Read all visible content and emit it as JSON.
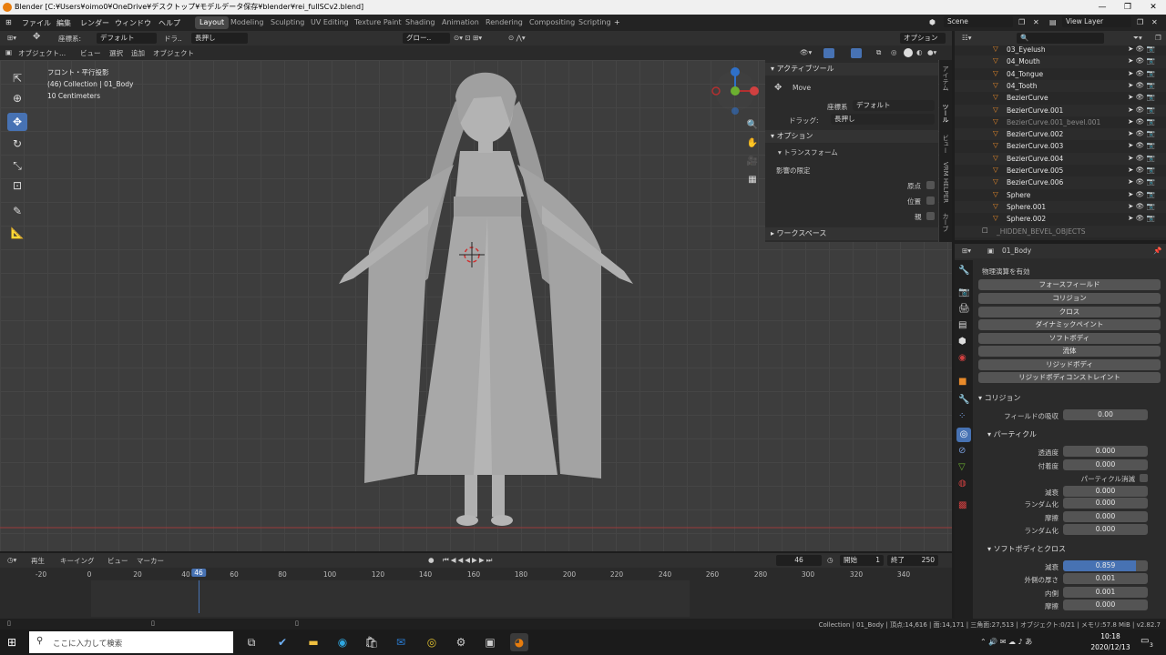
{
  "window": {
    "title": "Blender [C:¥Users¥oimo0¥OneDrive¥デスクトップ¥モデルデータ保存¥blender¥rei_fullSCv2.blend]"
  },
  "menu": [
    "ファイル",
    "編集",
    "レンダー",
    "ウィンドウ",
    "ヘルプ"
  ],
  "workspaces": [
    "Layout",
    "Modeling",
    "Sculpting",
    "UV Editing",
    "Texture Paint",
    "Shading",
    "Animation",
    "Rendering",
    "Compositing",
    "Scripting"
  ],
  "active_workspace": "Layout",
  "scene": "Scene",
  "view_layer": "View Layer",
  "viewport_header": {
    "coord_label": "座標系:",
    "coord_value": "デフォルト",
    "drag_label": "ドラ..",
    "drag_value": "長押し",
    "pivot": "グロー..",
    "options": "オプション"
  },
  "viewport_menu": {
    "mode": "オブジェクト...",
    "items": [
      "ビュー",
      "選択",
      "追加",
      "オブジェクト"
    ]
  },
  "viewport_info": [
    "フロント・平行投影",
    "(46) Collection | 01_Body",
    "10 Centimeters"
  ],
  "npanel": {
    "active_tool_title": "アクティブツール",
    "tool_name": "Move",
    "coord_label": "座標系",
    "coord_value": "デフォルト",
    "drag_label": "ドラッグ:",
    "drag_value": "長押し",
    "options_title": "オプション",
    "transform_title": "トランスフォーム",
    "affect_label": "影響の限定",
    "affect_items": [
      "原点",
      "位置",
      "親"
    ],
    "workspace_title": "ワークスペース",
    "tabs": [
      "アイテム",
      "ツール",
      "ビュー",
      "VRM HELPER",
      "カーブ"
    ]
  },
  "timeline": {
    "menus": [
      "再生",
      "キーイング",
      "ビュー",
      "マーカー"
    ],
    "current_frame": "46",
    "start_label": "開始",
    "start": "1",
    "end_label": "終了",
    "end": "250",
    "ticks": [
      "-20",
      "0",
      "20",
      "40",
      "46",
      "60",
      "80",
      "100",
      "120",
      "140",
      "160",
      "180",
      "200",
      "220",
      "240",
      "260",
      "280",
      "300",
      "320",
      "340"
    ]
  },
  "outliner": {
    "search_placeholder": "",
    "rows": [
      "03_Eyelush",
      "04_Mouth",
      "04_Tongue",
      "04_Tooth",
      "BezierCurve",
      "BezierCurve.001",
      "BezierCurve.001_bevel.001",
      "BezierCurve.002",
      "BezierCurve.003",
      "BezierCurve.004",
      "BezierCurve.005",
      "BezierCurve.006",
      "Sphere",
      "Sphere.001",
      "Sphere.002",
      "_HIDDEN_BEVEL_OBJECTS"
    ]
  },
  "properties": {
    "object_name": "01_Body",
    "physics_header": "物理演算を有効",
    "buttons": [
      "フォースフィールド",
      "コリジョン",
      "クロス",
      "ダイナミックペイント",
      "ソフトボディ",
      "流体",
      "リジッドボディ",
      "リジッドボディコンストレイント"
    ],
    "collision_title": "コリジョン",
    "field_absorption_label": "フィールドの吸収",
    "field_absorption": "0.00",
    "particle_title": "パーティクル",
    "permeability_label": "透過度",
    "permeability": "0.000",
    "stickiness_label": "付着度",
    "stickiness": "0.000",
    "kill_particles_label": "パーティクル消滅",
    "damping_label": "減衰",
    "damping": "0.000",
    "randomize_label": "ランダム化",
    "randomize": "0.000",
    "friction_label": "摩擦",
    "friction": "0.000",
    "randomize2_label": "ランダム化",
    "randomize2": "0.000",
    "softbody_title": "ソフトボディとクロス",
    "sb_damping_label": "減衰",
    "sb_damping": "0.859",
    "outer_label": "外側の厚さ",
    "outer": "0.001",
    "inner_label": "内側",
    "inner": "0.001",
    "sb_friction_label": "摩擦",
    "sb_friction": "0.000"
  },
  "statusbar": {
    "text": "Collection | 01_Body | 頂点:14,616 | 面:14,171 | 三角面:27,513 | オブジェクト:0/21 | メモリ:57.8 MiB | v2.82.7"
  },
  "taskbar": {
    "search_placeholder": "ここに入力して検索",
    "time": "10:18",
    "date": "2020/12/13",
    "notifications": "3"
  },
  "colors": {
    "accent": "#4772b3",
    "viewport_bg": "#3d3d3d",
    "model": "#a6a6a6",
    "red_axis": "#b23030",
    "green_axis": "#6cb030",
    "blue_axis": "#2f70c8"
  }
}
